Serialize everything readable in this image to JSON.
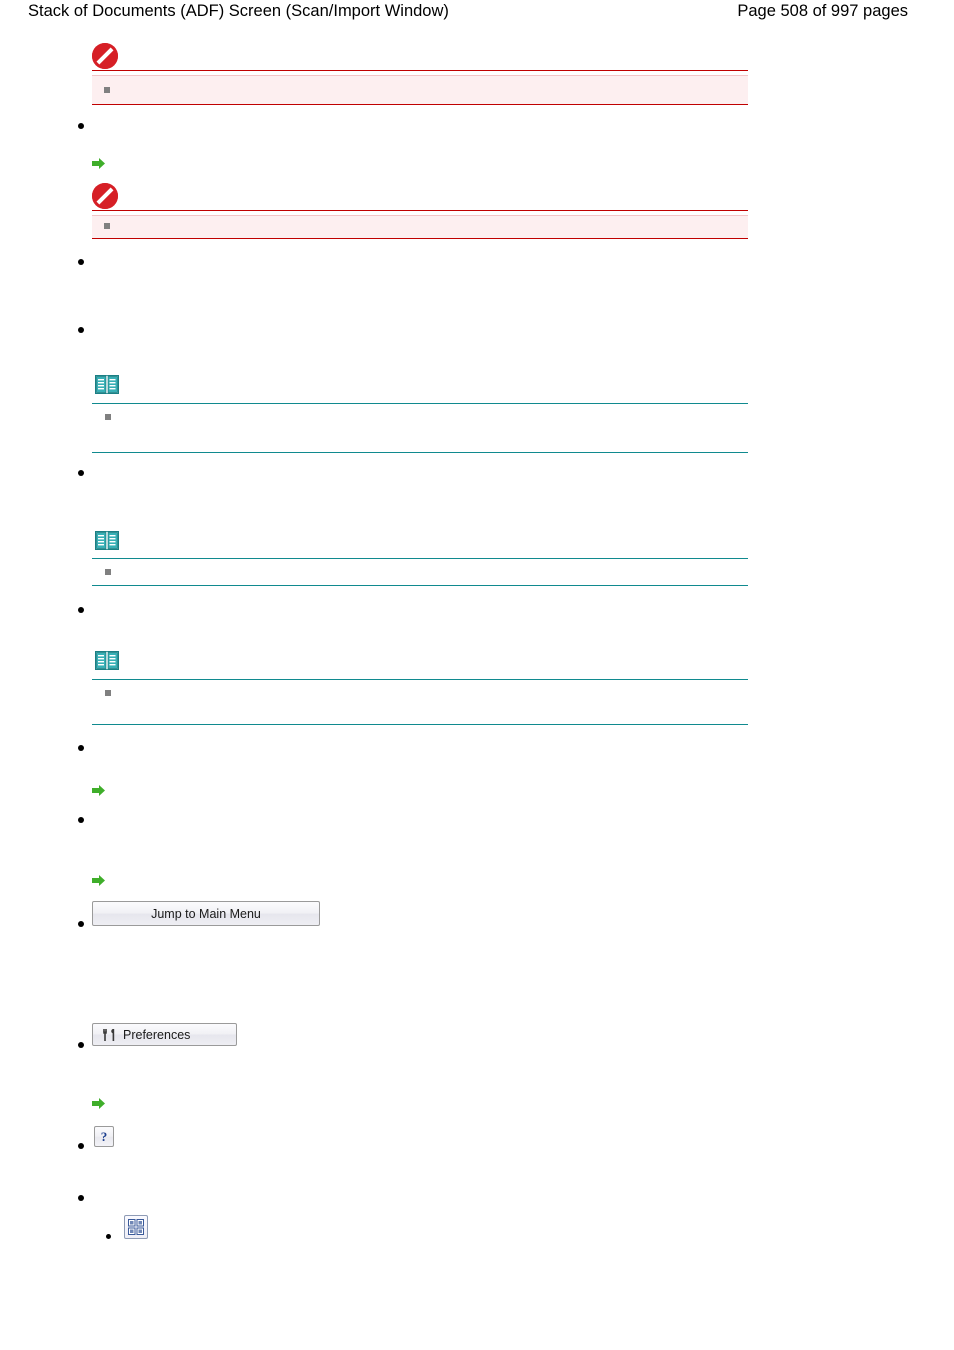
{
  "header": {
    "doc_title": "Stack of Documents (ADF) Screen (Scan/Import Window)",
    "page_label": "Page 508 of 997 pages"
  },
  "buttons": {
    "jump_to_main_menu": "Jump to Main Menu",
    "preferences": "Preferences",
    "help": "?"
  },
  "icons": {
    "prohibit": "prohibition-icon",
    "note_book": "note-book-icon",
    "arrow_link": "green-arrow-icon",
    "preferences": "preferences-tools-icon",
    "help": "help-question-icon",
    "grid": "grid-thumbnail-icon"
  },
  "colors": {
    "caution_rule": "#c00000",
    "caution_background": "#fdeff0",
    "note_rule": "#108a8f",
    "prohibit_red": "#d61f26",
    "arrow_green": "#3fae2a"
  }
}
